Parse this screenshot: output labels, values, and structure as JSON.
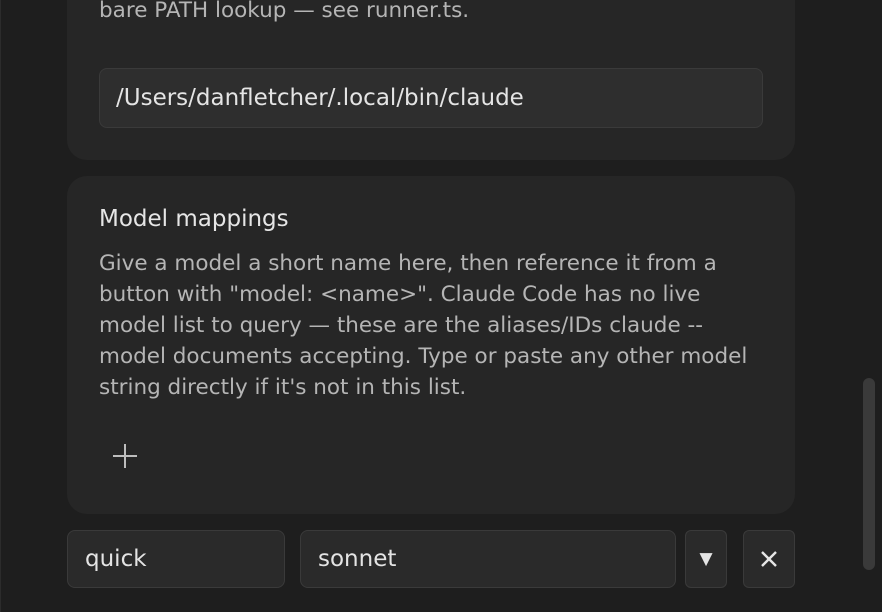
{
  "claude_path": {
    "description": "container), it falls back to a few known install locations, then bare PATH lookup — see runner.ts.",
    "value": "/Users/danfletcher/.local/bin/claude"
  },
  "model_mappings": {
    "title": "Model mappings",
    "description": "Give a model a short name here, then reference it from a button with \"model: <name>\". Claude Code has no live model list to query — these are the aliases/IDs claude --model documents accepting. Type or paste any other model string directly if it's not in this list.",
    "add_icon": "plus-icon",
    "rows": [
      {
        "name": "quick",
        "model": "sonnet",
        "dropdown_icon": "▼",
        "remove_icon": "close-icon"
      }
    ]
  }
}
